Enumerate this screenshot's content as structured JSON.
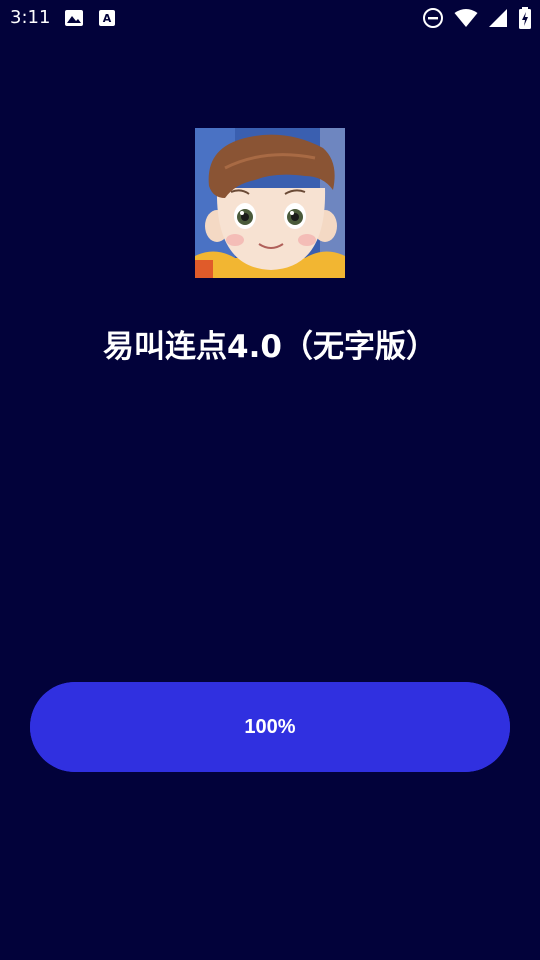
{
  "status_bar": {
    "time": "3:11",
    "left_icons": [
      "image-icon",
      "font-a-icon"
    ],
    "right_icons": [
      "do-not-disturb-icon",
      "wifi-icon",
      "cellular-signal-icon",
      "battery-charging-icon"
    ]
  },
  "app": {
    "icon": "cartoon-boy-avatar",
    "title": "易叫连点4.0（无字版）"
  },
  "progress": {
    "label": "100%",
    "value": 1.0
  },
  "colors": {
    "background": "#02023a",
    "accent": "#3030e0",
    "text": "#ffffff"
  }
}
